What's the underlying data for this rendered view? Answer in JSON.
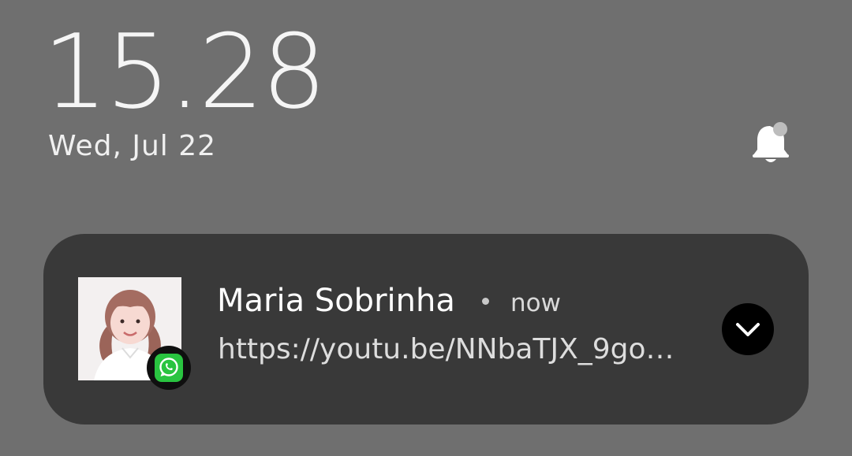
{
  "lockscreen": {
    "time": "15.28",
    "date": "Wed, Jul 22",
    "notification_bell_icon": "bell-with-dot"
  },
  "notification": {
    "sender": "Maria Sobrinha",
    "separator": "•",
    "timestamp": "now",
    "message": "https://youtu.be/NNbaTJX_9go…",
    "avatar_icon": "contact-photo",
    "app_icon": "whatsapp-icon",
    "expand_icon": "chevron-down-icon"
  },
  "colors": {
    "background": "#6f6f6f",
    "card": "#393939",
    "whatsapp_green": "#29c440"
  }
}
